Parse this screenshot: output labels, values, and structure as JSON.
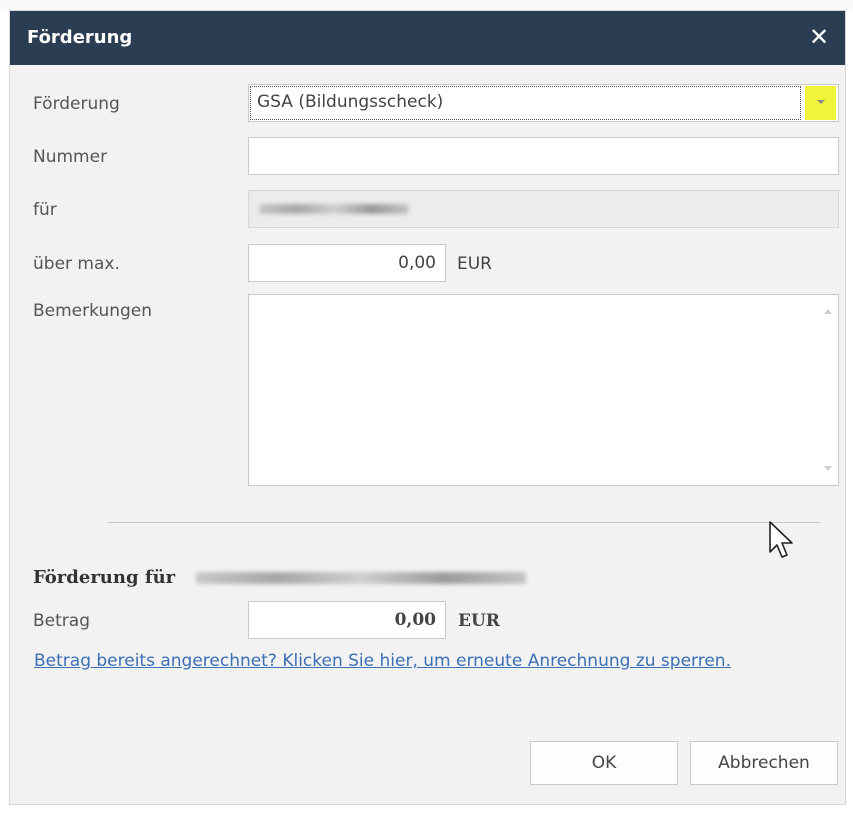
{
  "dialog": {
    "title": "Förderung",
    "close_icon": "close-icon"
  },
  "form": {
    "foerderung": {
      "label": "Förderung",
      "value": "GSA (Bildungsscheck)",
      "dropdown_icon": "chevron-down-icon"
    },
    "nummer": {
      "label": "Nummer",
      "value": ""
    },
    "fuer": {
      "label": "für"
    },
    "ueber_max": {
      "label": "über max.",
      "value": "0,00",
      "unit": "EUR"
    },
    "bemerkungen": {
      "label": "Bemerkungen",
      "value": ""
    }
  },
  "section": {
    "heading": "Förderung für",
    "betrag": {
      "label": "Betrag",
      "value": "0,00",
      "unit": "EUR"
    }
  },
  "link_text": "Betrag bereits angerechnet? Klicken Sie hier, um erneute Anrechnung zu sperren.",
  "buttons": {
    "ok": "OK",
    "cancel": "Abbrechen"
  },
  "colors": {
    "titlebar": "#2b3d52",
    "highlight": "#f1f53a",
    "link": "#3b6fb6"
  }
}
